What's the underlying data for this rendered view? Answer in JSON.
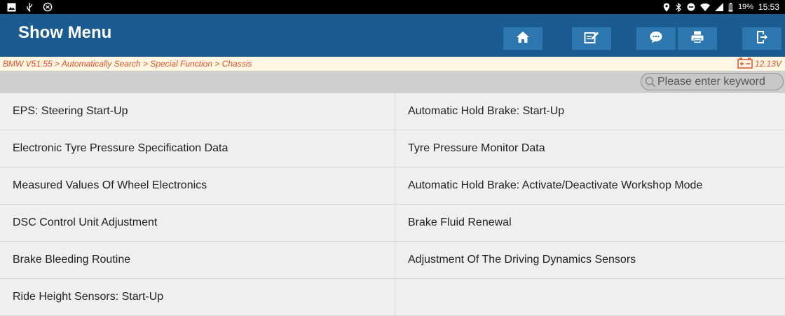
{
  "status_bar": {
    "battery_percent": "19%",
    "time": "15:53",
    "icons": [
      "image-icon",
      "usb-icon",
      "no-disturb-icon",
      "location-icon",
      "bluetooth-icon",
      "minus-circle-icon",
      "wifi-icon",
      "signal-icon",
      "battery-icon"
    ]
  },
  "header": {
    "title": "Show Menu",
    "buttons": [
      {
        "name": "home",
        "icon": "home-icon"
      },
      {
        "name": "edit",
        "icon": "edit-icon"
      },
      {
        "name": "chat",
        "icon": "chat-icon"
      },
      {
        "name": "print",
        "icon": "print-icon"
      },
      {
        "name": "exit",
        "icon": "exit-icon"
      }
    ]
  },
  "breadcrumb": {
    "path": "BMW V51.55 > Automatically Search > Special Function > Chassis",
    "voltage": "12.13V"
  },
  "search": {
    "placeholder": "Please enter keyword",
    "value": ""
  },
  "menu": {
    "items": [
      "EPS: Steering Start-Up",
      "Automatic Hold Brake: Start-Up",
      "Electronic Tyre Pressure Specification Data",
      "Tyre Pressure Monitor Data",
      "Measured Values Of Wheel Electronics",
      "Automatic Hold Brake: Activate/Deactivate Workshop Mode",
      "DSC Control Unit Adjustment",
      "Brake Fluid Renewal",
      "Brake Bleeding Routine",
      "Adjustment Of The Driving Dynamics Sensors",
      "Ride Height Sensors: Start-Up",
      ""
    ]
  },
  "colors": {
    "header_bg": "#1b5b8f",
    "button_bg": "#2d77b0",
    "breadcrumb_text": "#e2542c",
    "breadcrumb_bg": "#fdf6e3",
    "cell_bg": "#efefef"
  }
}
